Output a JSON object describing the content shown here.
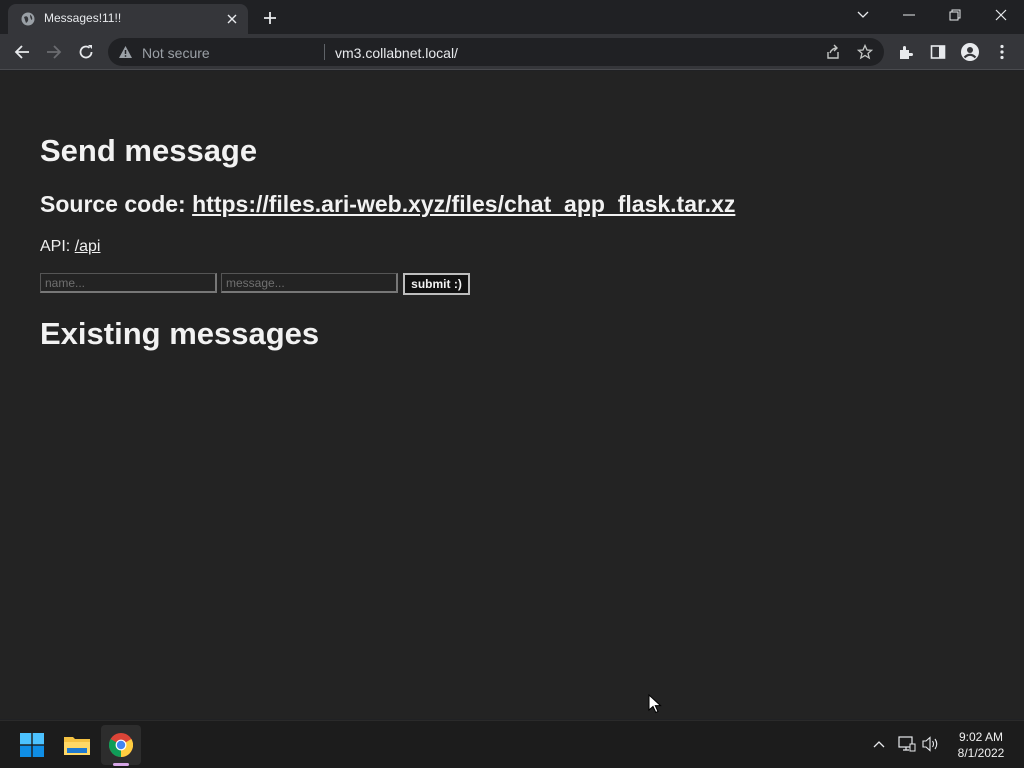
{
  "browser": {
    "tab": {
      "title": "Messages!11!!"
    },
    "omnibox": {
      "security_label": "Not secure",
      "url": "vm3.collabnet.local/"
    }
  },
  "page": {
    "heading_send": "Send message",
    "source_prefix": "Source code: ",
    "source_link": "https://files.ari-web.xyz/files/chat_app_flask.tar.xz",
    "api_prefix": "API: ",
    "api_link": "/api",
    "form": {
      "name_placeholder": "name...",
      "message_placeholder": "message...",
      "submit_label": "submit :)"
    },
    "heading_existing": "Existing messages"
  },
  "taskbar": {
    "apps": [
      "start-icon",
      "file-explorer-icon",
      "chrome-icon"
    ],
    "clock": {
      "time": "9:02 AM",
      "date": "8/1/2022"
    }
  },
  "colors": {
    "page_bg": "#232323",
    "browser_frame": "#202124",
    "toolbar": "#35363a",
    "taskbar": "#1c1c1c"
  }
}
